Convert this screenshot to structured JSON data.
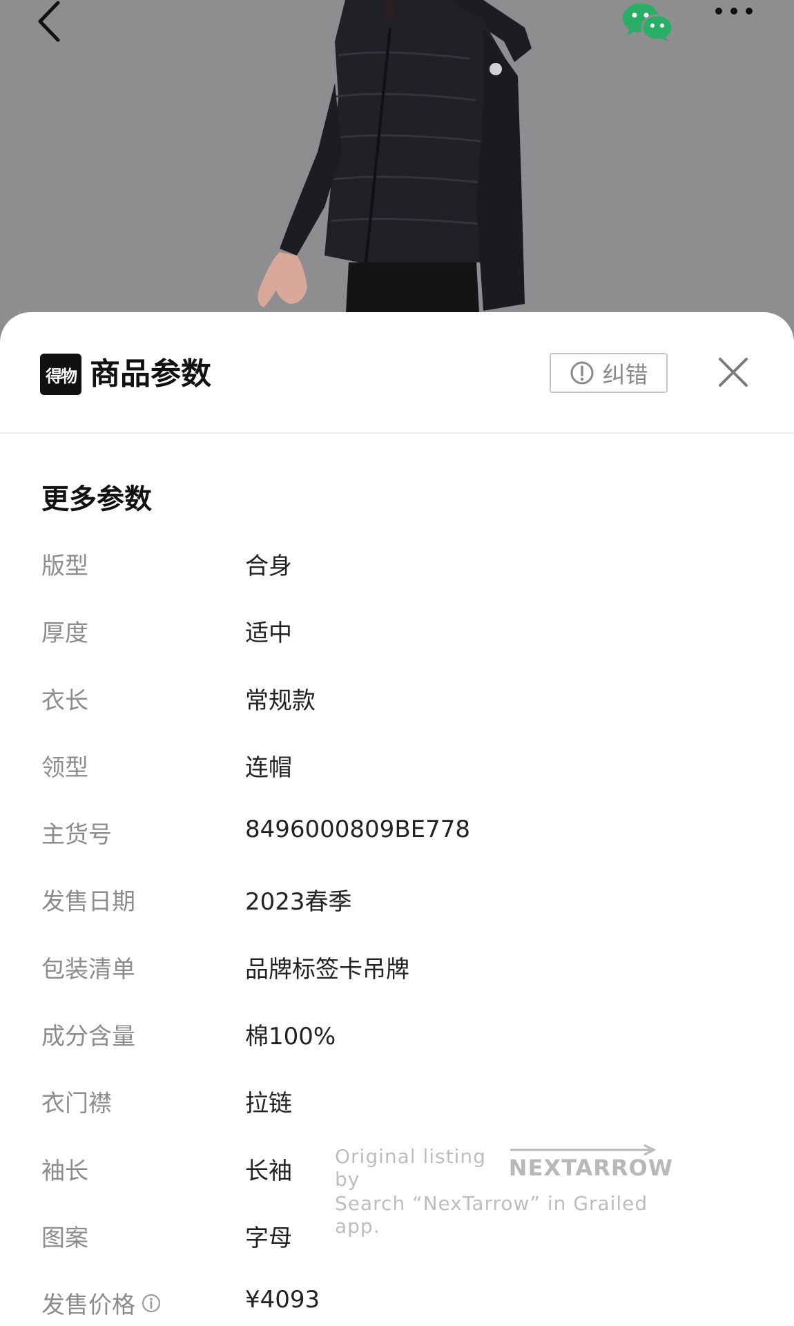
{
  "topbar": {
    "back_icon": "back-arrow-icon",
    "share_icon": "wechat-icon",
    "more_icon": "more-dots-icon"
  },
  "sheet": {
    "brand_logo_text": "得物",
    "title": "商品参数",
    "correct_button_label": "纠错",
    "correct_icon": "alert-circle-icon",
    "close_icon": "close-icon"
  },
  "section": {
    "title": "更多参数"
  },
  "params": [
    {
      "label": "版型",
      "value": "合身"
    },
    {
      "label": "厚度",
      "value": "适中"
    },
    {
      "label": "衣长",
      "value": "常规款"
    },
    {
      "label": "领型",
      "value": "连帽"
    },
    {
      "label": "主货号",
      "value": "8496000809BE778"
    },
    {
      "label": "发售日期",
      "value": "2023春季"
    },
    {
      "label": "包装清单",
      "value": "品牌标签卡吊牌"
    },
    {
      "label": "成分含量",
      "value": "棉100%"
    },
    {
      "label": "衣门襟",
      "value": "拉链"
    },
    {
      "label": "袖长",
      "value": "长袖"
    },
    {
      "label": "图案",
      "value": "字母"
    },
    {
      "label": "发售价格",
      "value": "¥4093",
      "has_info_icon": true
    }
  ],
  "watermark": {
    "line1_prefix": "Original listing by",
    "brand": "NEXTARROW",
    "line2": "Search “NexTarrow” in Grailed app."
  },
  "colors": {
    "photo_bg": "#8e8e91",
    "sheet_bg": "#ffffff",
    "label_gray": "#8c8c8c",
    "value_dark": "#222222",
    "wechat_green": "#2aae67"
  }
}
